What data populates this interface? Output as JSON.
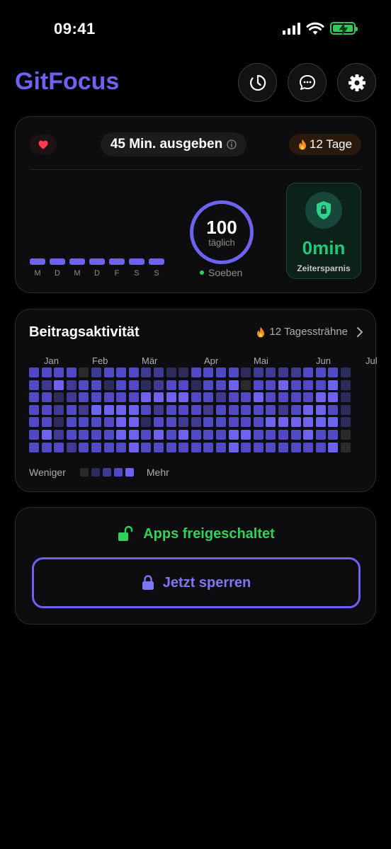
{
  "status_bar": {
    "time": "09:41"
  },
  "header": {
    "title": "GitFocus",
    "buttons": [
      {
        "icon": "timer-icon"
      },
      {
        "icon": "chat-icon"
      },
      {
        "icon": "gear-icon"
      }
    ]
  },
  "summary": {
    "spend_label": "45 Min. ausgeben",
    "days_label": "12 Tage",
    "weekdays": [
      "M",
      "D",
      "M",
      "D",
      "F",
      "S",
      "S"
    ],
    "ring_value": "100",
    "ring_unit": "täglich",
    "updated_label": "Soeben",
    "saving_value": "0min",
    "saving_label": "Zeitersparnis"
  },
  "activity": {
    "title": "Beitragsaktivität",
    "streak_label": "12 Tagessträhne",
    "months": [
      "Jan",
      "Feb",
      "Mär",
      "Apr",
      "Mai",
      "Jun",
      "Jul"
    ],
    "legend_less": "Weniger",
    "legend_more": "Mehr",
    "colors": [
      "#2a2a2d",
      "#2d2a5c",
      "#3e3991",
      "#5048c4",
      "#6d63f0"
    ],
    "grid_levels": [
      "33330233322113333122223331",
      "32423313312331334033433341",
      "33123333344443323343333441",
      "33232444432333233333234431",
      "33133334413322333334444441",
      "34233334434343334433334330",
      "33323333433333334333333340"
    ]
  },
  "lock_card": {
    "unlocked_label": "Apps freigeschaltet",
    "lock_button_label": "Jetzt sperren"
  }
}
